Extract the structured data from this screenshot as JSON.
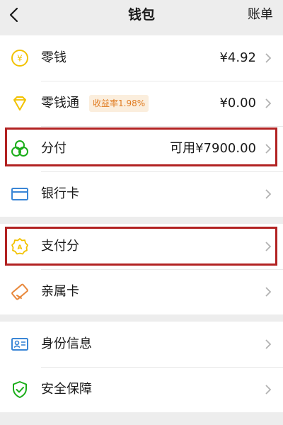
{
  "header": {
    "title": "钱包",
    "right_action": "账单"
  },
  "group1": [
    {
      "label": "零钱",
      "value": "¥4.92",
      "icon": "yuan-coin-icon"
    },
    {
      "label": "零钱通",
      "badge": "收益率1.98%",
      "value": "¥0.00",
      "icon": "diamond-icon"
    },
    {
      "label": "分付",
      "value": "可用¥7900.00",
      "icon": "fenfu-icon",
      "highlighted": true
    },
    {
      "label": "银行卡",
      "value": "",
      "icon": "bank-card-icon"
    }
  ],
  "group2": [
    {
      "label": "支付分",
      "value": "",
      "icon": "credit-score-icon",
      "highlighted": true
    },
    {
      "label": "亲属卡",
      "value": "",
      "icon": "family-card-icon"
    }
  ],
  "group3": [
    {
      "label": "身份信息",
      "value": "",
      "icon": "id-card-icon"
    },
    {
      "label": "安全保障",
      "value": "",
      "icon": "shield-icon"
    }
  ],
  "colors": {
    "background": "#ededed",
    "highlight": "#b22222",
    "green": "#1aad19",
    "gold": "#f2c200",
    "badge_text": "#e07b20",
    "badge_bg": "#fbeedd"
  }
}
